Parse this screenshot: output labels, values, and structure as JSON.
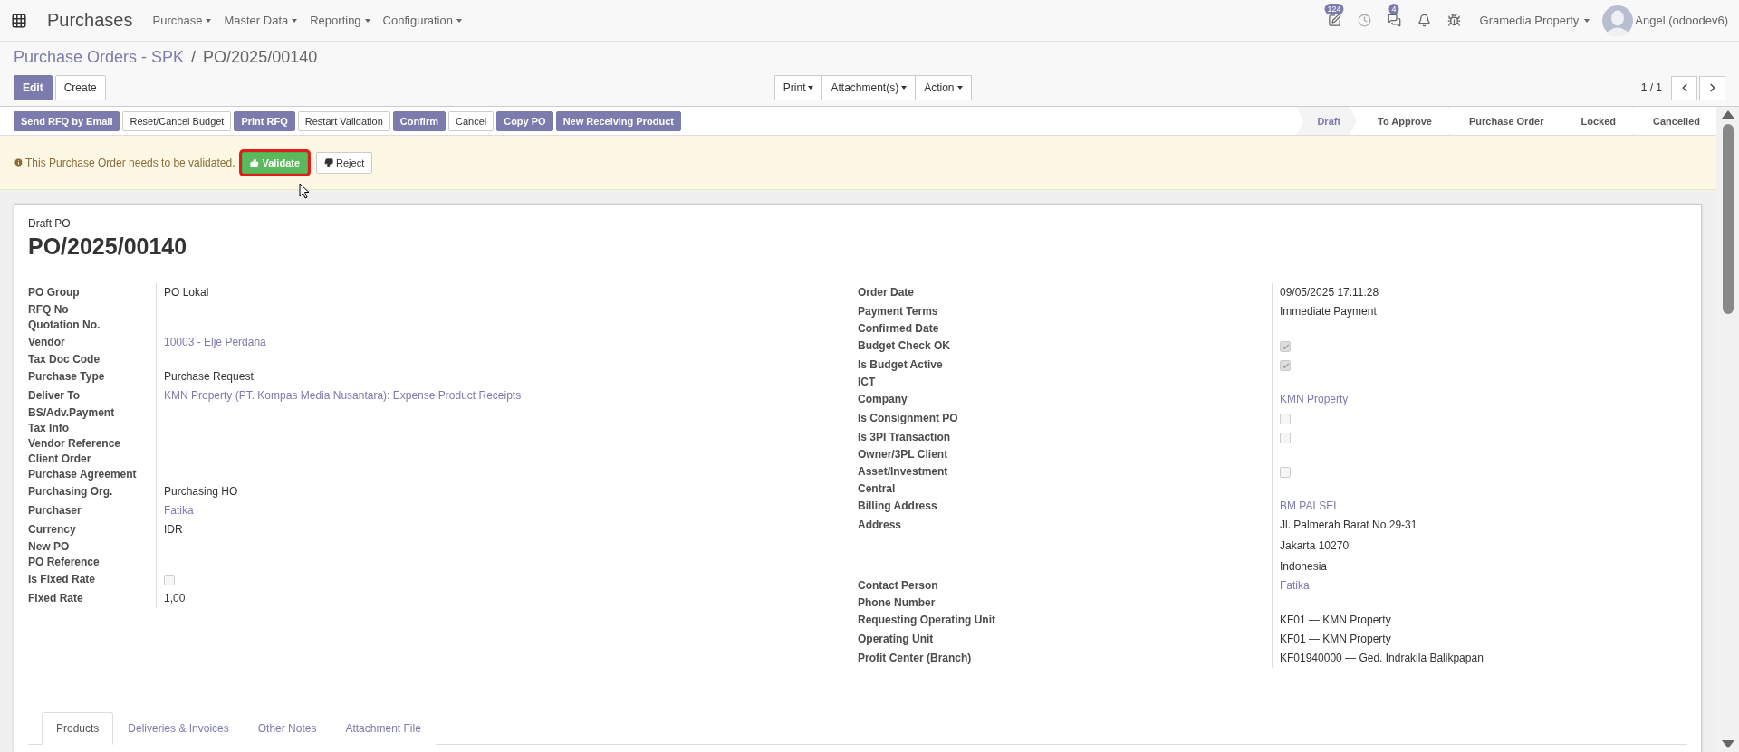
{
  "navbar": {
    "app": "Purchases",
    "menus": [
      "Purchase",
      "Master Data",
      "Reporting",
      "Configuration"
    ],
    "indicators": [
      {
        "kind": "edit",
        "badge": "124"
      },
      {
        "kind": "clock"
      },
      {
        "kind": "chat",
        "badge": "4"
      },
      {
        "kind": "bell"
      },
      {
        "kind": "bug"
      }
    ],
    "company": "Gramedia Property",
    "user": "Angel (odoodev6)"
  },
  "breadcrumb": {
    "parent": "Purchase Orders - SPK",
    "separator": "/",
    "current": "PO/2025/00140"
  },
  "control_buttons": [
    {
      "label": "Edit",
      "primary": true
    },
    {
      "label": "Create",
      "primary": false
    }
  ],
  "sidebar_menus": [
    "Print",
    "Attachment(s)",
    "Action"
  ],
  "pager": {
    "value": "1 / 1"
  },
  "header_buttons": [
    {
      "label": "Send RFQ by Email",
      "primary": true
    },
    {
      "label": "Reset/Cancel Budget",
      "primary": false
    },
    {
      "label": "Print RFQ",
      "primary": true
    },
    {
      "label": "Restart Validation",
      "primary": false
    },
    {
      "label": "Confirm",
      "primary": true
    },
    {
      "label": "Cancel",
      "primary": false
    },
    {
      "label": "Copy PO",
      "primary": true
    },
    {
      "label": "New Receiving Product",
      "primary": true
    }
  ],
  "status_steps": [
    {
      "label": "Draft",
      "selected": true
    },
    {
      "label": "To Approve",
      "selected": false
    },
    {
      "label": "Purchase Order",
      "selected": false
    },
    {
      "label": "Locked",
      "selected": false
    },
    {
      "label": "Cancelled",
      "selected": false
    }
  ],
  "alert": {
    "message": "This Purchase Order needs to be validated.",
    "buttons": [
      {
        "label": "Validate",
        "kind": "validate"
      },
      {
        "label": "Reject",
        "kind": "reject"
      }
    ]
  },
  "form": {
    "subtitle": "Draft PO",
    "title": "PO/2025/00140",
    "left": [
      {
        "label": "PO Group",
        "kind": "text",
        "value": "PO Lokal"
      },
      {
        "label": "RFQ No",
        "kind": "empty"
      },
      {
        "label": "Quotation No.",
        "kind": "empty"
      },
      {
        "label": "Vendor",
        "kind": "link",
        "value": "10003 - Elje Perdana"
      },
      {
        "label": "Tax Doc Code",
        "kind": "empty"
      },
      {
        "label": "Purchase Type",
        "kind": "text",
        "value": "Purchase Request"
      },
      {
        "label": "Deliver To",
        "kind": "link",
        "value": "KMN Property (PT. Kompas Media Nusantara): Expense Product Receipts"
      },
      {
        "label": "BS/Adv.Payment",
        "kind": "empty"
      },
      {
        "label": "Tax Info",
        "kind": "empty"
      },
      {
        "label": "Vendor Reference",
        "kind": "empty"
      },
      {
        "label": "Client Order",
        "kind": "empty"
      },
      {
        "label": "Purchase Agreement",
        "kind": "empty"
      },
      {
        "label": "Purchasing Org.",
        "kind": "text",
        "value": "Purchasing HO"
      },
      {
        "label": "Purchaser",
        "kind": "link",
        "value": "Fatika"
      },
      {
        "label": "Currency",
        "kind": "text",
        "value": "IDR"
      },
      {
        "label": "New PO",
        "kind": "empty"
      },
      {
        "label": "PO Reference",
        "kind": "empty"
      },
      {
        "label": "Is Fixed Rate",
        "kind": "checkbox",
        "checked": false
      },
      {
        "label": "Fixed Rate",
        "kind": "text",
        "value": "1,00"
      }
    ],
    "right": [
      {
        "label": "Order Date",
        "kind": "text",
        "value": "09/05/2025 17:11:28"
      },
      {
        "label": "Payment Terms",
        "kind": "text",
        "value": "Immediate Payment"
      },
      {
        "label": "Confirmed Date",
        "kind": "empty"
      },
      {
        "label": "Budget Check OK",
        "kind": "checkbox",
        "checked": true
      },
      {
        "label": "Is Budget Active",
        "kind": "checkbox",
        "checked": true
      },
      {
        "label": "ICT",
        "kind": "empty"
      },
      {
        "label": "Company",
        "kind": "link",
        "value": "KMN Property"
      },
      {
        "label": "Is Consignment PO",
        "kind": "checkbox",
        "checked": false
      },
      {
        "label": "Is 3PI Transaction",
        "kind": "checkbox",
        "checked": false
      },
      {
        "label": "Owner/3PL Client",
        "kind": "empty"
      },
      {
        "label": "Asset/Investment",
        "kind": "checkbox",
        "checked": false
      },
      {
        "label": "Central",
        "kind": "empty"
      },
      {
        "label": "Billing Address",
        "kind": "link",
        "value": "BM PALSEL"
      },
      {
        "label": "Address",
        "kind": "lines",
        "lines": [
          "Jl. Palmerah Barat No.29-31",
          "Jakarta  10270",
          "Indonesia"
        ]
      },
      {
        "label": "Contact Person",
        "kind": "link",
        "value": "Fatika"
      },
      {
        "label": "Phone Number",
        "kind": "empty"
      },
      {
        "label": "Requesting Operating Unit",
        "kind": "text",
        "value": "KF01 — KMN Property"
      },
      {
        "label": "Operating Unit",
        "kind": "text",
        "value": "KF01 — KMN Property"
      },
      {
        "label": "Profit Center (Branch)",
        "kind": "text",
        "value": "KF01940000 — Ged. Indrakila Balikpapan"
      }
    ]
  },
  "tabs": [
    {
      "label": "Products",
      "selected": true
    },
    {
      "label": "Deliveries & Invoices",
      "selected": false
    },
    {
      "label": "Other Notes",
      "selected": false
    },
    {
      "label": "Attachment File",
      "selected": false
    }
  ]
}
